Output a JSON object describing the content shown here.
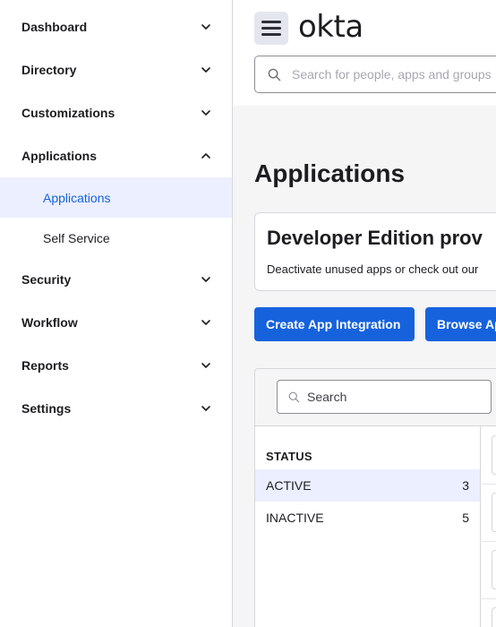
{
  "sidebar": {
    "items": [
      {
        "label": "Dashboard",
        "icon": "chevron-down-icon"
      },
      {
        "label": "Directory",
        "icon": "chevron-down-icon"
      },
      {
        "label": "Customizations",
        "icon": "chevron-down-icon"
      },
      {
        "label": "Applications",
        "icon": "chevron-up-icon"
      },
      {
        "label": "Security",
        "icon": "chevron-down-icon"
      },
      {
        "label": "Workflow",
        "icon": "chevron-down-icon"
      },
      {
        "label": "Reports",
        "icon": "chevron-down-icon"
      },
      {
        "label": "Settings",
        "icon": "chevron-down-icon"
      }
    ],
    "subitems": [
      {
        "label": "Applications",
        "active": true
      },
      {
        "label": "Self Service",
        "active": false
      }
    ]
  },
  "header": {
    "logo": "okta",
    "search_placeholder": "Search for people, apps and groups"
  },
  "main": {
    "title": "Applications",
    "banner": {
      "title": "Developer Edition prov",
      "text": "Deactivate unused apps or check out our"
    },
    "buttons": {
      "create": "Create App Integration",
      "browse": "Browse Ap"
    },
    "panel": {
      "search_placeholder": "Search",
      "status_heading": "STATUS",
      "statuses": [
        {
          "label": "ACTIVE",
          "count": "3",
          "selected": true
        },
        {
          "label": "INACTIVE",
          "count": "5",
          "selected": false
        }
      ]
    }
  },
  "colors": {
    "accent": "#1662dd",
    "selected_bg": "#ebefff",
    "page_bg": "#f5f5f6"
  }
}
